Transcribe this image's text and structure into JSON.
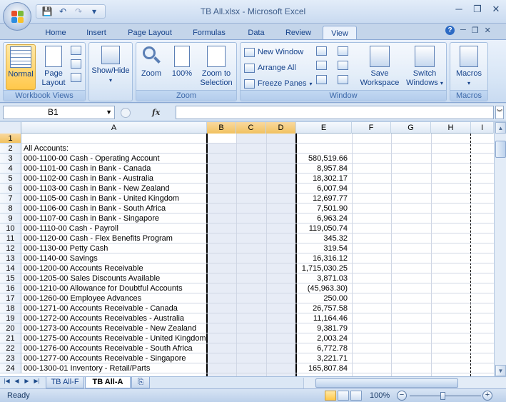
{
  "window": {
    "title": "TB All.xlsx - Microsoft Excel",
    "minimize": "─",
    "restore": "❐",
    "close": "✕"
  },
  "quick_access": {
    "save_icon": "💾",
    "undo_icon": "↶",
    "redo_icon": "↷",
    "customize_icon": "▾"
  },
  "ribbon_tabs": [
    "Home",
    "Insert",
    "Page Layout",
    "Formulas",
    "Data",
    "Review",
    "View"
  ],
  "active_tab": "View",
  "ribbon_controls": {
    "help": "?",
    "min": "─",
    "restore": "❐",
    "close": "✕"
  },
  "groups": {
    "workbook_views": {
      "label": "Workbook Views",
      "normal": "Normal",
      "page_layout_1": "Page",
      "page_layout_2": "Layout"
    },
    "show_hide": {
      "label": "Show/Hide"
    },
    "zoom": {
      "label": "Zoom",
      "zoom": "Zoom",
      "hundred": "100%",
      "zoom_sel_1": "Zoom to",
      "zoom_sel_2": "Selection"
    },
    "window": {
      "label": "Window",
      "new_window": "New Window",
      "arrange_all": "Arrange All",
      "freeze_panes": "Freeze Panes",
      "save_ws_1": "Save",
      "save_ws_2": "Workspace",
      "switch_1": "Switch",
      "switch_2": "Windows"
    },
    "macros": {
      "label": "Macros",
      "macros": "Macros"
    }
  },
  "formula_bar": {
    "name_box": "B1",
    "fx": "fx",
    "value": ""
  },
  "columns": [
    "A",
    "B",
    "C",
    "D",
    "E",
    "F",
    "G",
    "H",
    "I"
  ],
  "rows": [
    {
      "n": "1",
      "a": "",
      "e": ""
    },
    {
      "n": "2",
      "a": "All Accounts:",
      "e": ""
    },
    {
      "n": "3",
      "a": "000-1100-00 Cash - Operating Account",
      "e": "580,519.66"
    },
    {
      "n": "4",
      "a": "000-1101-00 Cash in Bank - Canada",
      "e": "8,957.84"
    },
    {
      "n": "5",
      "a": "000-1102-00 Cash in Bank - Australia",
      "e": "18,302.17"
    },
    {
      "n": "6",
      "a": "000-1103-00 Cash in Bank - New Zealand",
      "e": "6,007.94"
    },
    {
      "n": "7",
      "a": "000-1105-00 Cash in Bank - United Kingdom",
      "e": "12,697.77"
    },
    {
      "n": "8",
      "a": "000-1106-00 Cash in Bank - South Africa",
      "e": "7,501.90"
    },
    {
      "n": "9",
      "a": "000-1107-00 Cash in Bank - Singapore",
      "e": "6,963.24"
    },
    {
      "n": "10",
      "a": "000-1110-00 Cash - Payroll",
      "e": "119,050.74"
    },
    {
      "n": "11",
      "a": "000-1120-00 Cash - Flex Benefits Program",
      "e": "345.32"
    },
    {
      "n": "12",
      "a": "000-1130-00 Petty Cash",
      "e": "319.54"
    },
    {
      "n": "13",
      "a": "000-1140-00 Savings",
      "e": "16,316.12"
    },
    {
      "n": "14",
      "a": "000-1200-00 Accounts Receivable",
      "e": "1,715,030.25"
    },
    {
      "n": "15",
      "a": "000-1205-00 Sales Discounts Available",
      "e": "3,871.03"
    },
    {
      "n": "16",
      "a": "000-1210-00 Allowance for Doubtful Accounts",
      "e": "(45,963.30)"
    },
    {
      "n": "17",
      "a": "000-1260-00 Employee Advances",
      "e": "250.00"
    },
    {
      "n": "18",
      "a": "000-1271-00 Accounts Receivable - Canada",
      "e": "26,757.58"
    },
    {
      "n": "19",
      "a": "000-1272-00 Accounts Receivables - Australia",
      "e": "11,164.46"
    },
    {
      "n": "20",
      "a": "000-1273-00 Accounts Receivable - New Zealand",
      "e": "9,381.79"
    },
    {
      "n": "21",
      "a": "000-1275-00 Accounts Receivable - United Kingdom",
      "e": "2,003.24"
    },
    {
      "n": "22",
      "a": "000-1276-00 Accounts Receivable - South Africa",
      "e": "6,772.78"
    },
    {
      "n": "23",
      "a": "000-1277-00 Accounts Receivable - Singapore",
      "e": "3,221.71"
    },
    {
      "n": "24",
      "a": "000-1300-01 Inventory - Retail/Parts",
      "e": "165,807.84"
    }
  ],
  "sheets": [
    "TB All-F",
    "TB All-A"
  ],
  "active_sheet": "TB All-A",
  "status": {
    "ready": "Ready",
    "zoom": "100%",
    "minus": "−",
    "plus": "+"
  }
}
